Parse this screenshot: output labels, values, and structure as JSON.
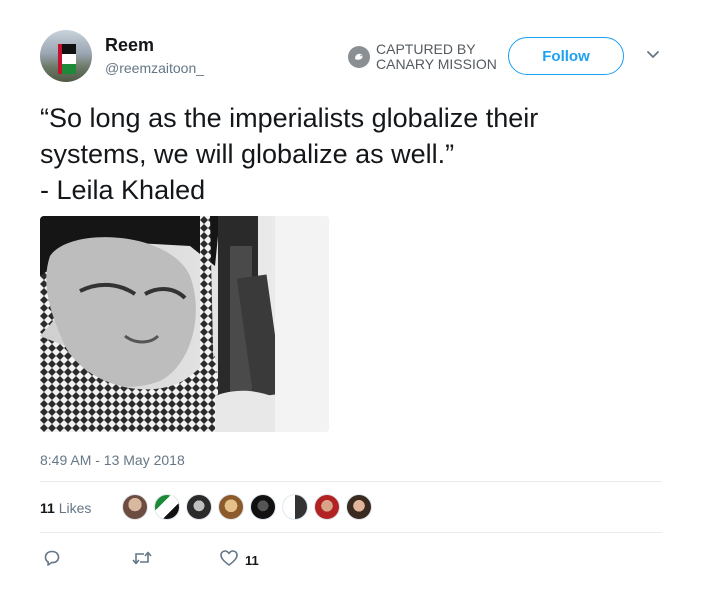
{
  "header": {
    "name": "Reem",
    "handle": "@reemzaitoon_",
    "follow_label": "Follow"
  },
  "watermark": {
    "line1": "Captured by",
    "line2": "Canary Mission"
  },
  "tweet": {
    "text": "“So long as the imperialists globalize their\nsystems, we will globalize as well.”\n- Leila Khaled",
    "timestamp": "8:49 AM - 13 May 2018"
  },
  "likes": {
    "count": "11",
    "label": "Likes",
    "avatars": [
      "liker-1",
      "liker-2",
      "liker-3",
      "liker-4",
      "liker-5",
      "liker-6",
      "liker-7",
      "liker-8"
    ]
  },
  "actions": {
    "reply_count": "",
    "retweet_count": "",
    "like_count": "11"
  },
  "colors": {
    "accent": "#1da1f2",
    "muted": "#657786",
    "divider": "#e6ecf0"
  },
  "icons": [
    "chevron-down-icon",
    "reply-icon",
    "retweet-icon",
    "heart-icon",
    "canary-bird-icon"
  ]
}
